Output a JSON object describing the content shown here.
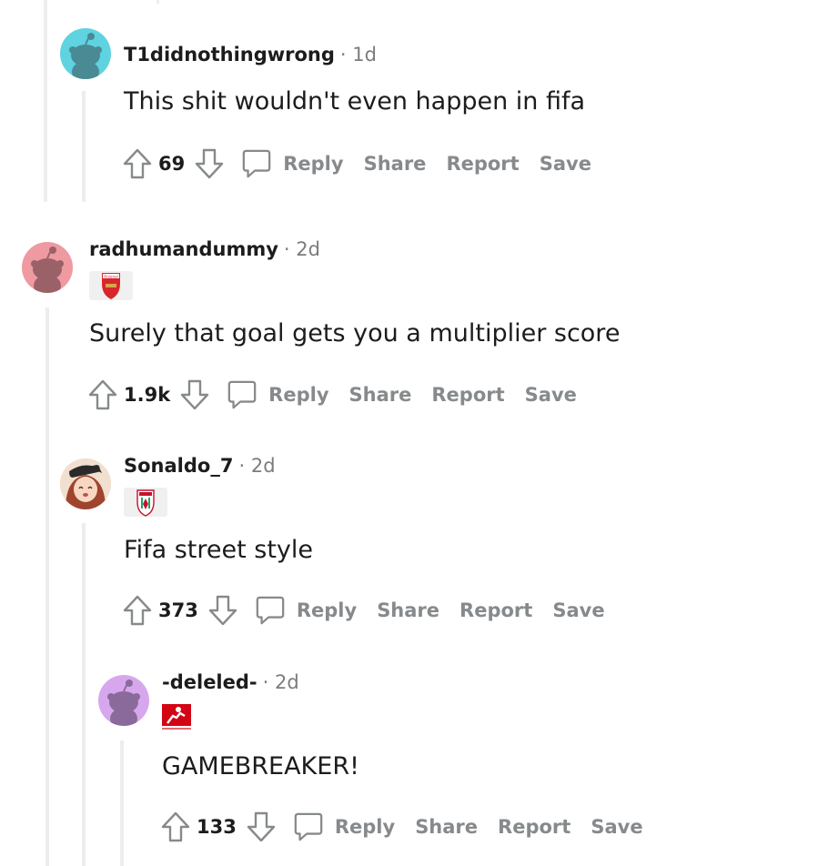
{
  "comments": [
    {
      "username": "T1didnothingwrong",
      "time": "1d",
      "body": "This shit wouldn't even happen in fifa",
      "score": "69",
      "avatar_color": "#5fd3e0"
    },
    {
      "username": "radhumandummy",
      "time": "2d",
      "body": "Surely that goal gets you a multiplier score",
      "score": "1.9k",
      "avatar_color": "#ee9aa0",
      "flair_text": "Arsenal"
    },
    {
      "username": "Sonaldo_7",
      "time": "2d",
      "body": "Fifa street style",
      "score": "373"
    },
    {
      "username": "-deleled-",
      "time": "2d",
      "body": "GAMEBREAKER!",
      "score": "133",
      "avatar_color": "#d7a7ee"
    }
  ],
  "actions": {
    "reply": "Reply",
    "share": "Share",
    "report": "Report",
    "save": "Save"
  },
  "separator": "·"
}
